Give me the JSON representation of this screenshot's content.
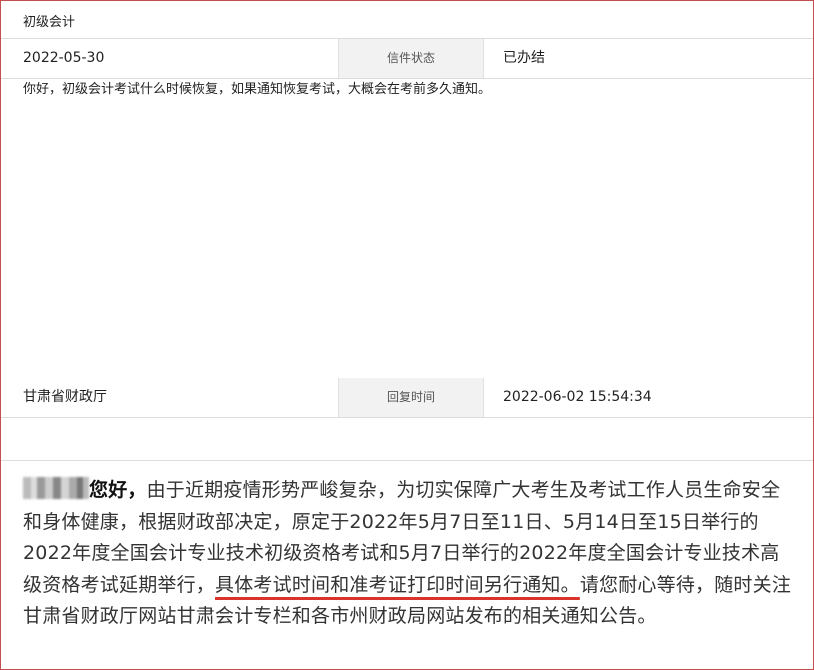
{
  "category": "初级会计",
  "letter": {
    "date": "2022-05-30",
    "status_label": "信件状态",
    "status_value": "已办结"
  },
  "question_text": "你好，初级会计考试什么时候恢复，如果通知恢复考试，大概会在考前多久通知。",
  "reply_meta": {
    "department": "甘肃省财政厅",
    "time_label": "回复时间",
    "time_value": "2022-06-02 15:54:34"
  },
  "reply": {
    "greeting": "您好，",
    "body_part1": "由于近期疫情形势严峻复杂，为切实保障广大考生及考试工作人员生命安全和身体健康，根据财政部决定，原定于2022年5月7日至11日、5月14日至15日举行的2022年度全国会计专业技术初级资格考试和5月7日举行的2022年度全国会计专业技术高级资格考试延期举行，",
    "body_highlight": "具体考试时间和准考证打印时间另行通知。",
    "body_part2": "请您耐心等待，随时关注甘肃省财政厅网站甘肃会计专栏和各市州财政局网站发布的相关通知公告。"
  }
}
